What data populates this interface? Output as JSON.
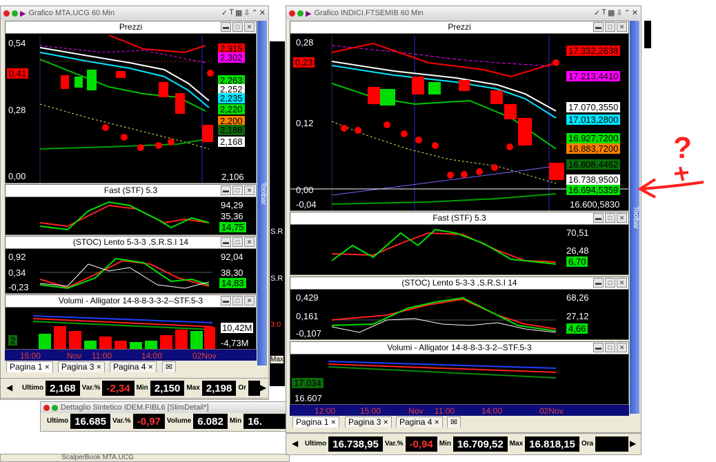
{
  "left_window": {
    "title": "Grafico MTA.UCG 60 Min",
    "toolbar_label": "Toolbar",
    "price_panel": {
      "title": "Prezzi",
      "y_labels": [
        "0,54",
        "0,28",
        "0,00"
      ],
      "left_tag": "0,41",
      "tags": [
        "2,315",
        "2,302",
        "2,263",
        "2,252",
        "2,235",
        "2,220",
        "2,200",
        "2,188",
        "2,168",
        "2,106"
      ]
    },
    "fast_panel": {
      "title": "Fast  (STF)   5.3",
      "labels": [
        "94,29",
        "35,36",
        "14,75"
      ]
    },
    "stoc_panel": {
      "title": "(STOC) Lento    5-3-3  ,S.R.S.I 14",
      "left_labels": [
        "0,92",
        "0,34",
        "-0,23"
      ],
      "labels": [
        "92,04",
        "38,30",
        "14,83"
      ]
    },
    "vol_panel": {
      "title": "Volumi  - Alligator 14-8-8-3-3-2--STF.5-3",
      "labels": [
        "10,42M",
        "-4,73M"
      ],
      "tag": "2"
    },
    "x_labels": [
      "15:00",
      "Nov",
      "11:00",
      "14:00",
      "02Nov"
    ],
    "tabs": [
      "Pagina 1",
      "Pagina 3",
      "Pagina 4"
    ],
    "quote": {
      "ultimo_label": "Ultimo",
      "ultimo": "2,168",
      "var_label": "Var.%",
      "var": "-2,34",
      "min_label": "Min",
      "min": "2,150",
      "max_label": "Max",
      "max": "2,198",
      "ora_label": "Or"
    }
  },
  "detail_window": {
    "title": "Dettaglio Sintetico IDEM.FIBL6 [SlimDetail*]",
    "ultimo_label": "Ultimo",
    "ultimo": "16.685",
    "var_label": "Var.%",
    "var": "-0,97",
    "vol_label": "Volume",
    "vol": "6.082",
    "min_label": "Min",
    "min": "16."
  },
  "bottom_window": {
    "title": "ScalperBook MTA.UCG"
  },
  "right_window": {
    "title": "Grafico INDICI.FTSEMIB 60 Min",
    "toolbar_label": "Toolbar",
    "price_panel": {
      "title": "Prezzi",
      "y_labels": [
        "0,28",
        "0,12",
        "0,00",
        "-0,04"
      ],
      "left_tag": "0,23",
      "tags": [
        "17.332,2638",
        "17.213,4410",
        "17.070,3550",
        "17.013,2800",
        "16.927,7200",
        "16.883,7200",
        "16.808,4462",
        "16.738,9500",
        "16.694,5359",
        "16.600,5830"
      ]
    },
    "fast_panel": {
      "title": "Fast  (STF)   5.3",
      "labels": [
        "70,51",
        "26,48",
        "6,70"
      ]
    },
    "stoc_panel": {
      "title": "(STOC) Lento    5-3-3  ,S.R.S.I 14",
      "left_labels": [
        "0,429",
        "0,161",
        "-0,107"
      ],
      "labels": [
        "68,26",
        "27,12",
        "4,66"
      ]
    },
    "vol_panel": {
      "title": "Volumi  - Alligator 14-8-8-3-3-2--STF.5-3",
      "labels": [
        "17.034",
        "16.607"
      ]
    },
    "x_labels": [
      "12:00",
      "15:00",
      "Nov",
      "11:00",
      "14:00",
      "02Nov"
    ],
    "tabs": [
      "Pagina 1",
      "Pagina 3",
      "Pagina 4"
    ],
    "quote": {
      "ultimo_label": "Ultimo",
      "ultimo": "16.738,95",
      "var_label": "Var.%",
      "var": "-0,94",
      "min_label": "Min",
      "min": "16.709,52",
      "max_label": "Max",
      "max": "16.818,15",
      "ora_label": "Ora"
    }
  },
  "middle_fragments": {
    "labels": [
      "S.R",
      "S.R",
      "3:0",
      "Max"
    ]
  },
  "annotation": {
    "text": "?"
  },
  "colors": {
    "red": "#ff0000",
    "green": "#00e000",
    "magenta": "#ff00ff",
    "cyan": "#00e5ff",
    "orange": "#ff8000",
    "darkgreen": "#0a6b0a"
  }
}
